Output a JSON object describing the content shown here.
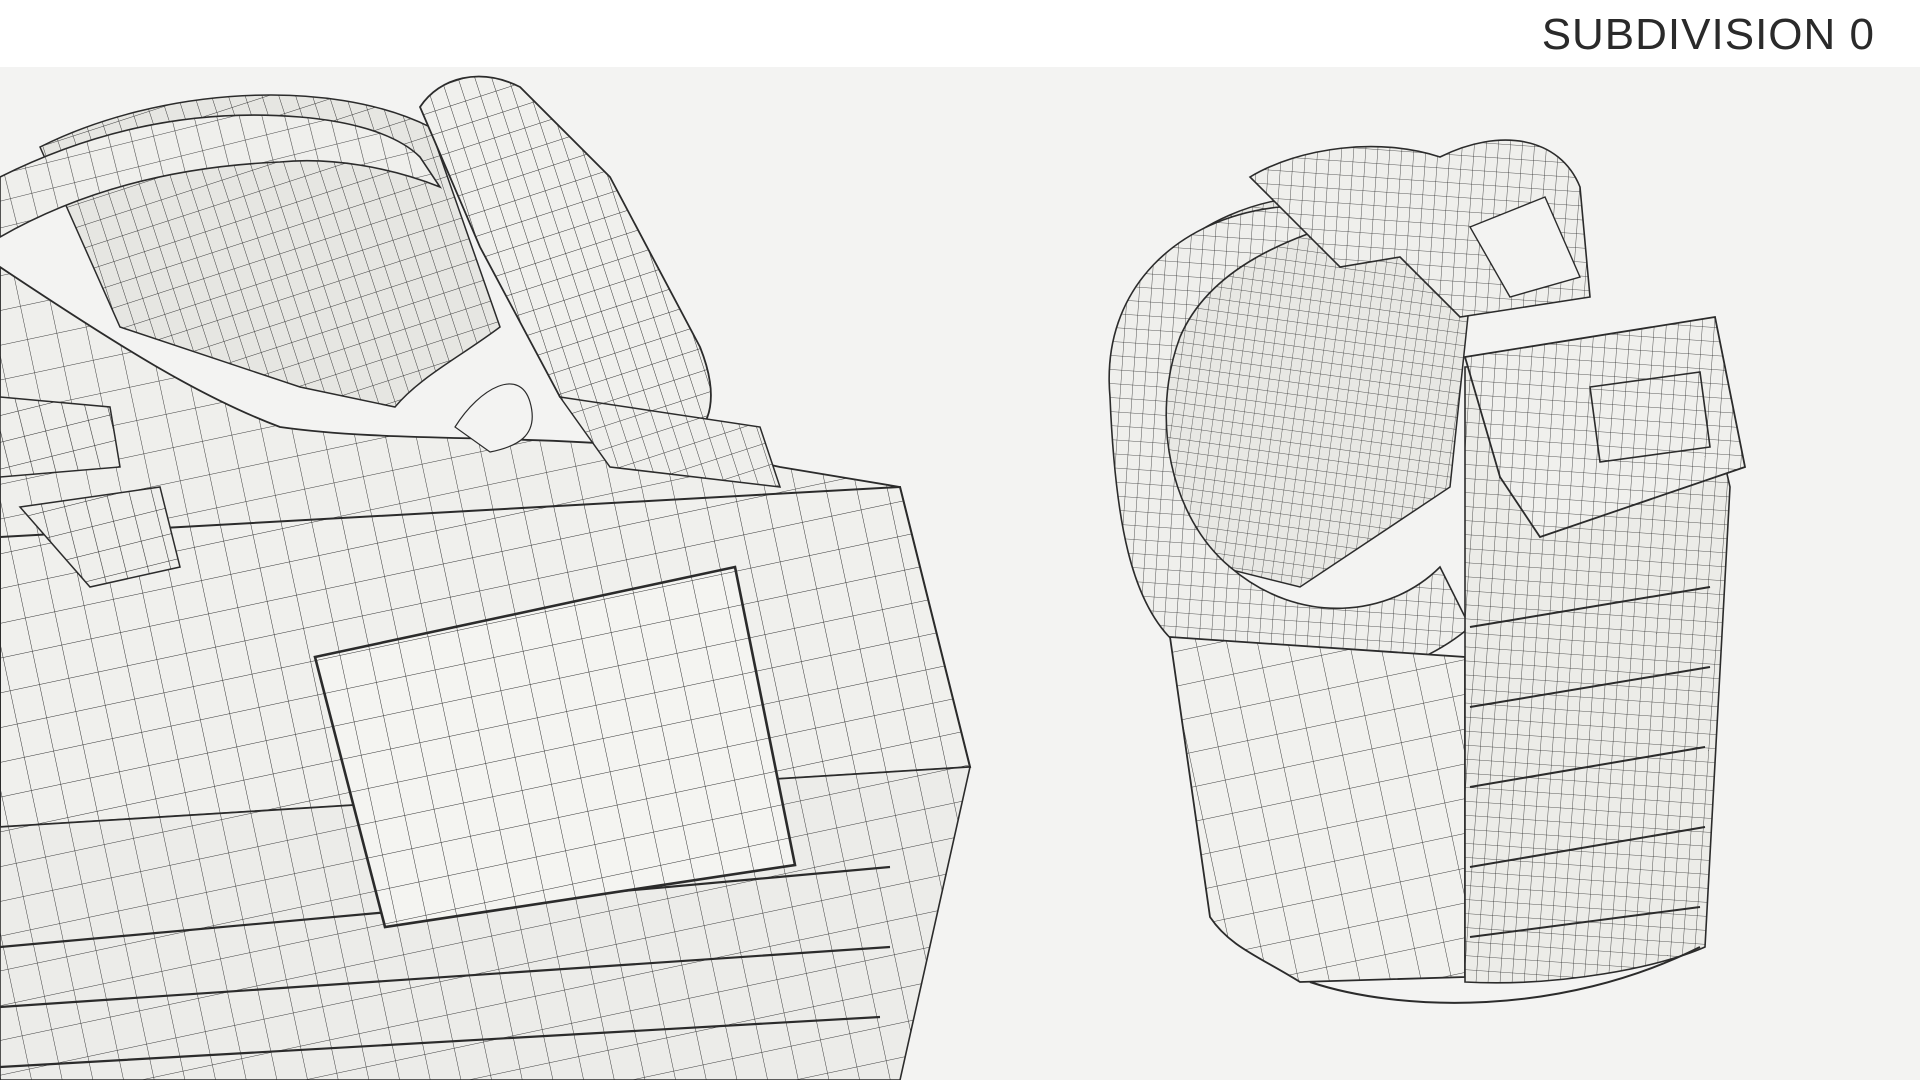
{
  "header": {
    "title": "SUBDIVISION 0"
  },
  "viewport": {
    "background_color": "#f3f3f2",
    "wire_color": "#2b2b2b",
    "surface_color": "#efefec",
    "views": [
      {
        "name": "close-up-vest-view"
      },
      {
        "name": "full-vest-three-quarter-view"
      }
    ]
  }
}
